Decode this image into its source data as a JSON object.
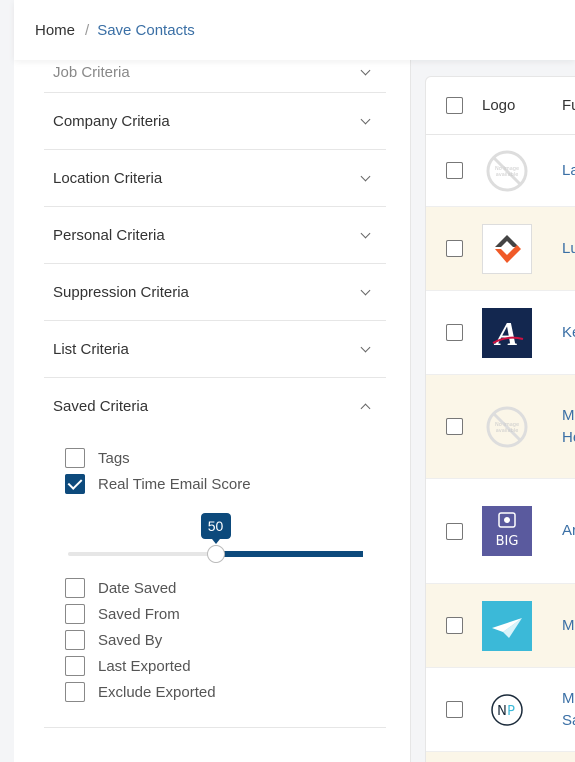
{
  "breadcrumb": {
    "home": "Home",
    "separator": "/",
    "current": "Save Contacts"
  },
  "criteria": {
    "job": "Job Criteria",
    "company": "Company Criteria",
    "location": "Location Criteria",
    "personal": "Personal Criteria",
    "suppression": "Suppression Criteria",
    "list": "List Criteria",
    "saved": "Saved Criteria"
  },
  "saved_options": {
    "tags": {
      "label": "Tags",
      "checked": false
    },
    "real_time_email_score": {
      "label": "Real Time Email Score",
      "checked": true
    },
    "slider_value": "50",
    "slider_fraction": 0.5,
    "date_saved": {
      "label": "Date Saved",
      "checked": false
    },
    "saved_from": {
      "label": "Saved From",
      "checked": false
    },
    "saved_by": {
      "label": "Saved By",
      "checked": false
    },
    "last_exported": {
      "label": "Last Exported",
      "checked": false
    },
    "exclude_exported": {
      "label": "Exclude Exported",
      "checked": false
    }
  },
  "table": {
    "columns": {
      "logo": "Logo",
      "full_name": "Fu"
    },
    "rows": [
      {
        "logo": "no-image-icon",
        "name": "La"
      },
      {
        "logo": "orange-diamond-logo",
        "name": "Lu"
      },
      {
        "logo": "braves-a-logo",
        "name": "Ke"
      },
      {
        "logo": "no-image-icon",
        "name": "M\nHe"
      },
      {
        "logo": "big-logo",
        "name": "Ar"
      },
      {
        "logo": "paper-plane-logo",
        "name": "M"
      },
      {
        "logo": "np-logo",
        "name": "M\nSa"
      }
    ]
  },
  "colors": {
    "accent": "#0d4a7c",
    "link": "#3a6fa5",
    "row_highlight": "#fbf6e8"
  }
}
